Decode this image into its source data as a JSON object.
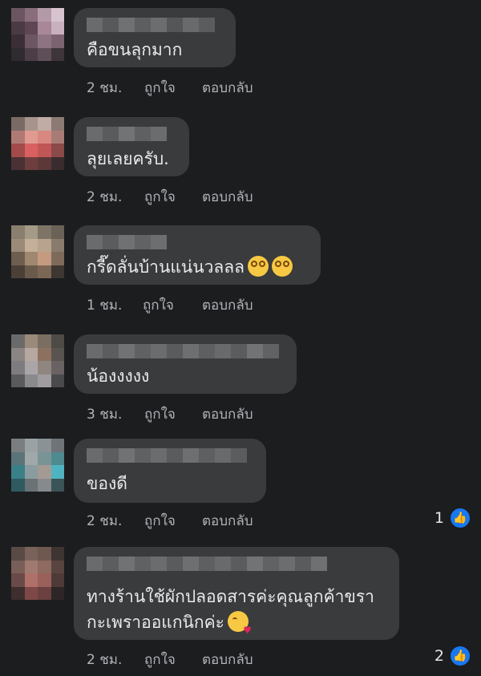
{
  "comments": [
    {
      "text": "คือขนลุกมาก",
      "time": "2 ชม.",
      "like_label": "ถูกใจ",
      "reply_label": "ตอบกลับ",
      "emoji": null,
      "reaction_count": null
    },
    {
      "text": "ลุยเลยครับ.",
      "time": "2 ชม.",
      "like_label": "ถูกใจ",
      "reply_label": "ตอบกลับ",
      "emoji": null,
      "reaction_count": null
    },
    {
      "text": "กรี๊ดลั่นบ้านแน่นวลลล",
      "time": "1 ชม.",
      "like_label": "ถูกใจ",
      "reply_label": "ตอบกลับ",
      "emoji": "woozy-face-emoji x2",
      "reaction_count": null
    },
    {
      "text": "น้องงงงง",
      "time": "3 ชม.",
      "like_label": "ถูกใจ",
      "reply_label": "ตอบกลับ",
      "emoji": null,
      "reaction_count": null
    },
    {
      "text": "ของดี",
      "time": "2 ชม.",
      "like_label": "ถูกใจ",
      "reply_label": "ตอบกลับ",
      "emoji": null,
      "reaction_count": "1"
    },
    {
      "text_line1": "ทางร้านใช้ผักปลอดสารค่ะคุณลูกค้าขรา",
      "text_line2": "กะเพราออแกนิกค่ะ",
      "time": "2 ชม.",
      "like_label": "ถูกใจ",
      "reply_label": "ตอบกลับ",
      "emoji": "face-blowing-kiss-emoji",
      "reaction_count": "2"
    }
  ],
  "colors": {
    "background": "#1c1d1f",
    "bubble": "#3a3b3c",
    "text": "#e9eaec",
    "meta": "#b0b3b8",
    "like_badge": "#1877f2"
  },
  "icons": {
    "reaction": "thumbs-up-icon"
  }
}
